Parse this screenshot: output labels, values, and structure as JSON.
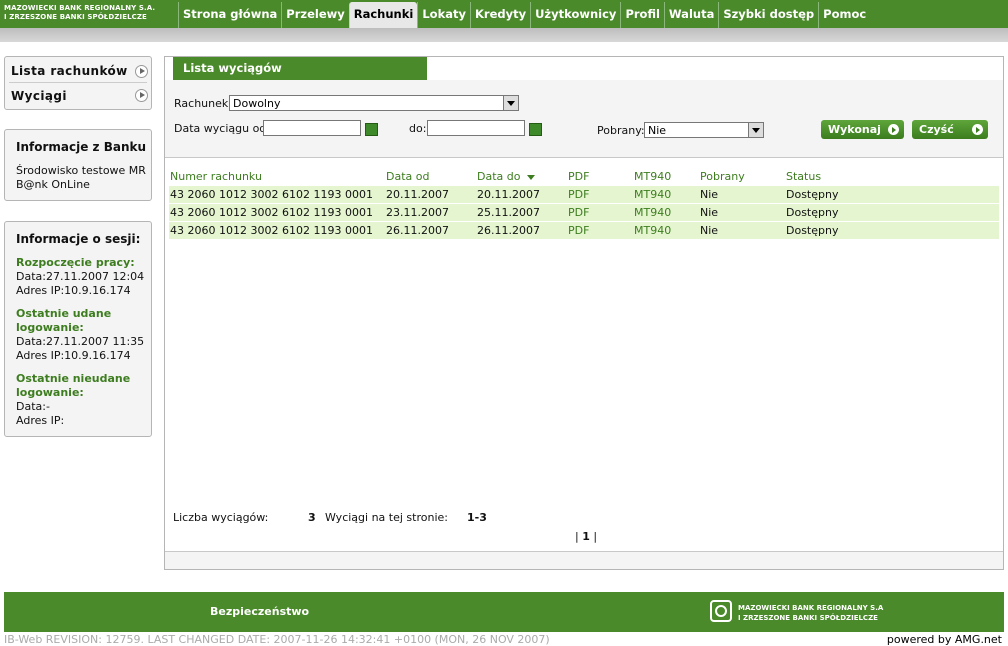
{
  "header": {
    "logo_line1": "MAZOWIECKI BANK REGIONALNY S.A.",
    "logo_line2": "I ZRZESZONE BANKI SPÓŁDZIELCZE",
    "nav": [
      "Strona główna",
      "Przelewy",
      "Rachunki",
      "Lokaty",
      "Kredyty",
      "Użytkownicy",
      "Profil",
      "Waluta",
      "Szybki dostęp",
      "Pomoc"
    ],
    "active_nav": "Rachunki"
  },
  "sidebar": {
    "menu": [
      "Lista rachunków",
      "Wyciągi"
    ],
    "bank_info_title": "Informacje z Banku",
    "bank_info_line1": "Środowisko testowe MR",
    "bank_info_line2": "B@nk OnLine",
    "session_title": "Informacje o sesji:",
    "start_label": "Rozpoczęcie pracy:",
    "start_date": "Data:27.11.2007 12:04",
    "start_ip": "Adres IP:10.9.16.174",
    "last_ok_label1": "Ostatnie udane",
    "last_ok_label2": "logowanie:",
    "last_ok_date": "Data:27.11.2007 11:35",
    "last_ok_ip": "Adres IP:10.9.16.174",
    "last_fail_label1": "Ostatnie nieudane",
    "last_fail_label2": "logowanie:",
    "last_fail_date": "Data:-",
    "last_fail_ip": "Adres IP:"
  },
  "main": {
    "title": "Lista wyciągów",
    "account_label": "Rachunek:",
    "account_value": "Dowolny",
    "date_from_label": "Data wyciągu od:",
    "date_from_value": "",
    "date_to_label": "do:",
    "date_to_value": "",
    "downloaded_label": "Pobrany:",
    "downloaded_value": "Nie",
    "execute_label": "Wykonaj",
    "clear_label": "Czyść",
    "columns": [
      "Numer rachunku",
      "Data od",
      "Data do",
      "PDF",
      "MT940",
      "Pobrany",
      "Status"
    ],
    "rows": [
      [
        "43 2060 1012 3002 6102 1193 0001",
        "20.11.2007",
        "20.11.2007",
        "PDF",
        "MT940",
        "Nie",
        "Dostępny"
      ],
      [
        "43 2060 1012 3002 6102 1193 0001",
        "23.11.2007",
        "25.11.2007",
        "PDF",
        "MT940",
        "Nie",
        "Dostępny"
      ],
      [
        "43 2060 1012 3002 6102 1193 0001",
        "26.11.2007",
        "26.11.2007",
        "PDF",
        "MT940",
        "Nie",
        "Dostępny"
      ]
    ],
    "count_label": "Liczba wyciągów:",
    "count_value": "3",
    "on_page_label": "Wyciągi na tej stronie:",
    "on_page_value": "1-3",
    "pager_current": "1"
  },
  "footer": {
    "security_link": "Bezpieczeństwo",
    "logo_line1": "MAZOWIECKI BANK REGIONALNY S.A",
    "logo_line2": "I ZRZESZONE BANKI SPÓŁDZIELCZE",
    "revision": "IB-Web REVISION: 12759. LAST CHANGED DATE: 2007-11-26 14:32:41 +0100 (MON, 26 NOV 2007)",
    "powered": "powered by AMG.net"
  }
}
